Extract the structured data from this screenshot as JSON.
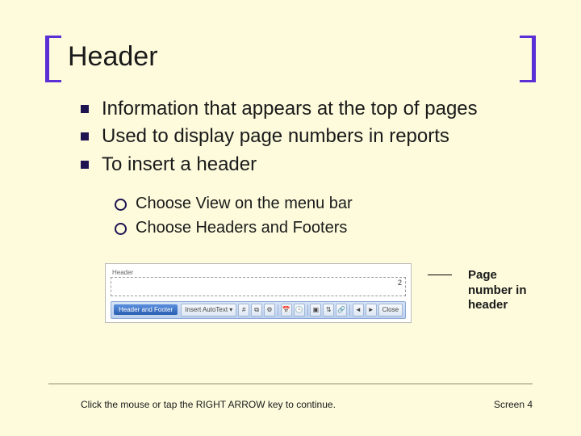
{
  "title": "Header",
  "bullets": [
    "Information that appears at the top of pages",
    "Used to display page numbers in reports",
    "To insert a header"
  ],
  "sub_bullets": [
    "Choose View on the menu bar",
    "Choose Headers and Footers"
  ],
  "figure": {
    "header_label": "Header",
    "page_number": "2",
    "toolbar_title": "Header and Footer",
    "insert_autotext": "Insert AutoText ▾",
    "close": "Close"
  },
  "callout": "Page number in header",
  "footer_instruction": "Click the mouse or tap the RIGHT ARROW key to continue.",
  "footer_screen": "Screen 4"
}
